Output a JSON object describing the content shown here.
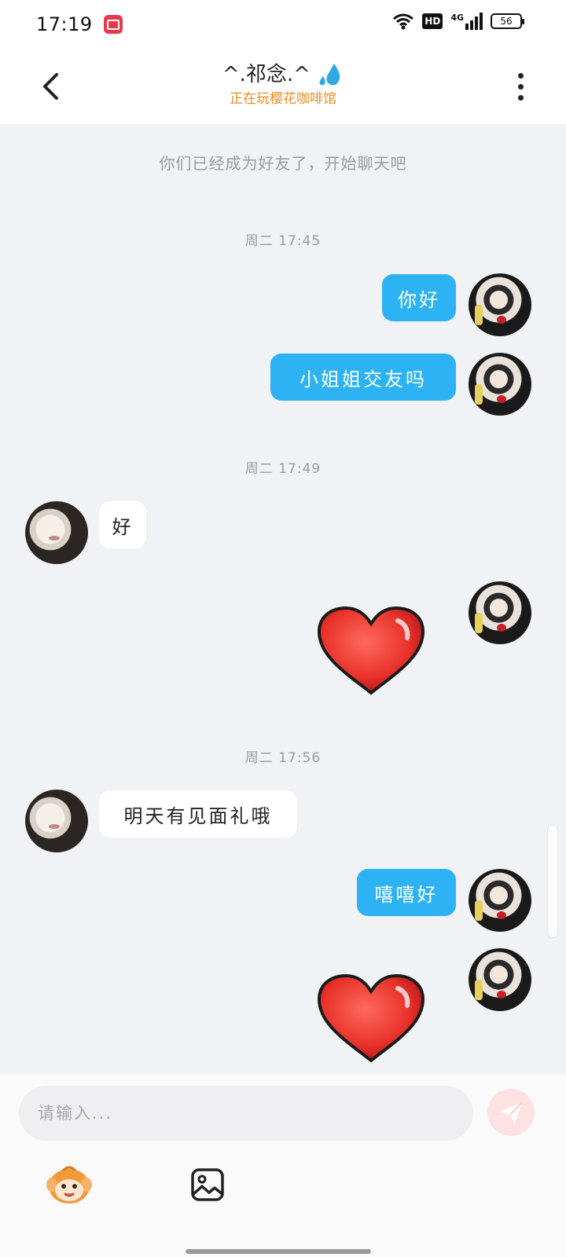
{
  "status_bar": {
    "time": "17:19",
    "network": "4G",
    "hd": "HD",
    "battery": "56",
    "icons": [
      "screen-record-icon",
      "wifi-icon",
      "hd-icon",
      "signal-icon",
      "battery-icon"
    ]
  },
  "header": {
    "title": "^.祁念.^",
    "subtitle": "正在玩樱花咖啡馆",
    "icons": [
      "back-arrow-icon",
      "water-drop-icon",
      "more-vertical-icon"
    ]
  },
  "chat": {
    "system_notice": "你们已经成为好友了，开始聊天吧",
    "messages": [
      {
        "type": "timestamp",
        "text": "周二 17:45"
      },
      {
        "type": "text",
        "from": "me",
        "text": "你好"
      },
      {
        "type": "text",
        "from": "me",
        "text": "小姐姐交友吗"
      },
      {
        "type": "timestamp",
        "text": "周二 17:49"
      },
      {
        "type": "text",
        "from": "other",
        "text": "好"
      },
      {
        "type": "sticker",
        "from": "me",
        "sticker": "heart-icon"
      },
      {
        "type": "timestamp",
        "text": "周二 17:56"
      },
      {
        "type": "text",
        "from": "other",
        "text": "明天有见面礼哦"
      },
      {
        "type": "text",
        "from": "me",
        "text": "嘻嘻好"
      },
      {
        "type": "sticker",
        "from": "me",
        "sticker": "heart-icon"
      }
    ]
  },
  "composer": {
    "placeholder": "请输入...",
    "icons": [
      "send-icon",
      "emoji-mascot-icon",
      "image-icon"
    ]
  },
  "colors": {
    "outgoing_bubble": "#2db3f3",
    "incoming_bubble": "#ffffff",
    "subtitle": "#f08a24",
    "send_button": "#fde2e2",
    "background": "#f1f2f5"
  }
}
